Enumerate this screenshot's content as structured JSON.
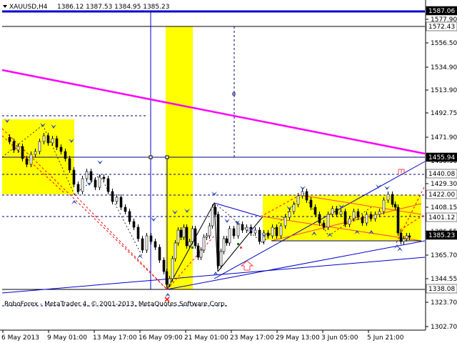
{
  "header": {
    "symbol": "XAUUSD,H4",
    "ohlc": "1386.12 1387.53 1384.95 1385.23"
  },
  "footer": {
    "copyright": "RoboForex - MetaTrader 4, © 2001-2013, MetaQuotes Software Corp."
  },
  "y_ticks": [
    "1577.90",
    "1556.50",
    "1534.90",
    "1513.90",
    "1492.75",
    "1471.90",
    "1450.30",
    "1429.30",
    "1408.15",
    "1386.55",
    "1365.70",
    "1344.55",
    "1323.70",
    "1302.70"
  ],
  "x_ticks": [
    "6 May 2013",
    "9 May 01:00",
    "13 May 17:00",
    "16 May 09:00",
    "21 May 01:00",
    "23 May 17:00",
    "29 May 13:00",
    "3 Jun 05:00",
    "5 Jun 21:00"
  ],
  "price_labels": [
    {
      "text": "1587.06",
      "style": "dark"
    },
    {
      "text": "1572.43",
      "style": "light"
    },
    {
      "text": "1455.94",
      "style": "dark"
    },
    {
      "text": "1440.08",
      "style": "light"
    },
    {
      "text": "1422.00",
      "style": "light"
    },
    {
      "text": "1401.12",
      "style": "light"
    },
    {
      "text": "1385.23",
      "style": "dark"
    },
    {
      "text": "1338.08",
      "style": "light"
    }
  ],
  "colors": {
    "magenta": "#ff00ff",
    "blue": "#0000cc",
    "navy": "#000080",
    "yellow": "#ffff00",
    "green": "#008000",
    "red": "#ff0000",
    "pink": "#ff4444",
    "black": "#000000"
  },
  "icons": {
    "menu": "triangle-down-icon",
    "up_arrow": "up-arrow-icon",
    "stop": "stop-sign-icon",
    "cross": "cross-icon"
  }
}
